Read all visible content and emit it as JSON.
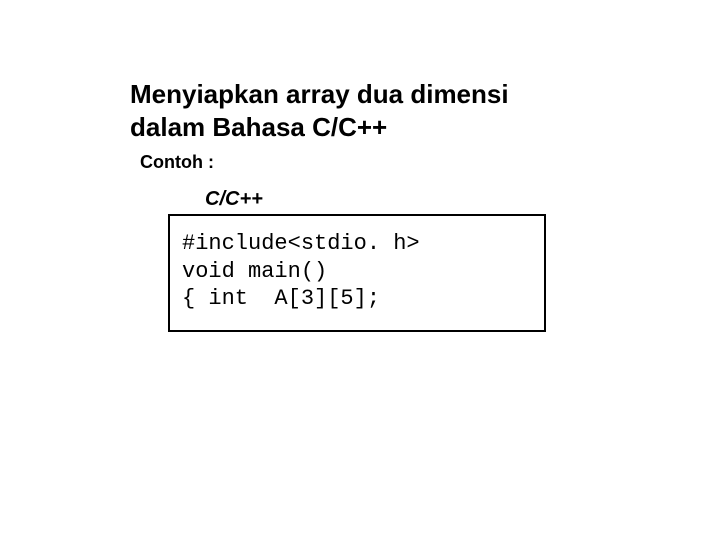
{
  "title": "Menyiapkan array dua dimensi dalam Bahasa C/C++",
  "subtitle": "Contoh :",
  "lang_label": "C/C++",
  "code": "#include<stdio. h>\nvoid main()\n{ int  A[3][5];"
}
